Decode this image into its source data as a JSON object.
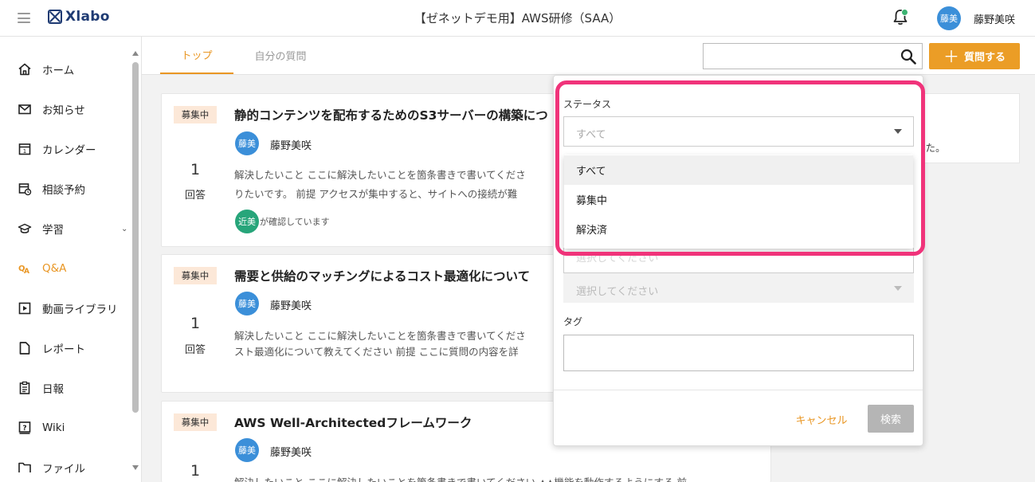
{
  "header": {
    "logo_text": "Xlabo",
    "course_title": "【ゼネットデモ用】AWS研修（SAA）",
    "user_avatar": "藤美",
    "user_name": "藤野美咲"
  },
  "sidebar": {
    "items": [
      {
        "label": "ホーム",
        "icon": "home-icon"
      },
      {
        "label": "お知らせ",
        "icon": "mail-icon"
      },
      {
        "label": "カレンダー",
        "icon": "calendar-icon"
      },
      {
        "label": "相談予約",
        "icon": "calendar-clock-icon"
      },
      {
        "label": "学習",
        "icon": "graduation-cap-icon"
      },
      {
        "label": "Q&A",
        "icon": "qa-icon"
      },
      {
        "label": "動画ライブラリ",
        "icon": "video-icon"
      },
      {
        "label": "レポート",
        "icon": "report-icon"
      },
      {
        "label": "日報",
        "icon": "daily-report-icon"
      },
      {
        "label": "Wiki",
        "icon": "wiki-icon"
      },
      {
        "label": "ファイル",
        "icon": "folder-icon"
      }
    ],
    "active_label": "Q&A",
    "accent_color": "#e99623"
  },
  "tabs": [
    {
      "label": "トップ"
    },
    {
      "label": "自分の質問"
    }
  ],
  "toolbar": {
    "search_value": "",
    "ask_label": "質問する"
  },
  "questions": [
    {
      "status": "募集中",
      "title": "静的コンテンツを配布するためのS3サーバーの構築につ",
      "author_avatar": "藤美",
      "author": "藤野美咲",
      "answer_count": "1",
      "answer_unit": "回答",
      "body_line1": "解決したいこと ここに解決したいことを箇条書きで書いてくださ",
      "body_line2": "りたいです。 前提 アクセスが集中すると、サイトへの接続が難",
      "viewer_avatar": "近美",
      "viewer_text": "が確認しています"
    },
    {
      "status": "募集中",
      "title": "需要と供給のマッチングによるコスト最適化について",
      "author_avatar": "藤美",
      "author": "藤野美咲",
      "answer_count": "1",
      "answer_unit": "回答",
      "body_line1": "解決したいこと ここに解決したいことを箇条書きで書いてくださ",
      "body_line2": "スト最適化について教えてください  前提 ここに質問の内容を詳"
    },
    {
      "status": "募集中",
      "title": "AWS Well-Architectedフレームワーク",
      "author_avatar": "藤美",
      "author": "藤野美咲",
      "answer_count": "1",
      "body_line1": "解決したいこと ここに解決したいことを箇条書きで書いてください ▲▲機能を動作するようにする 前"
    }
  ],
  "side_card": {
    "text": "した。"
  },
  "filter": {
    "status_label": "ステータス",
    "status_value": "すべて",
    "options": [
      "すべて",
      "募集中",
      "解決済"
    ],
    "faint_placeholder": "選択してください",
    "second_select_placeholder": "選択してください",
    "tag_label": "タグ",
    "cancel_label": "キャンセル",
    "search_label": "検索"
  },
  "annotation_color": "#f0337a"
}
